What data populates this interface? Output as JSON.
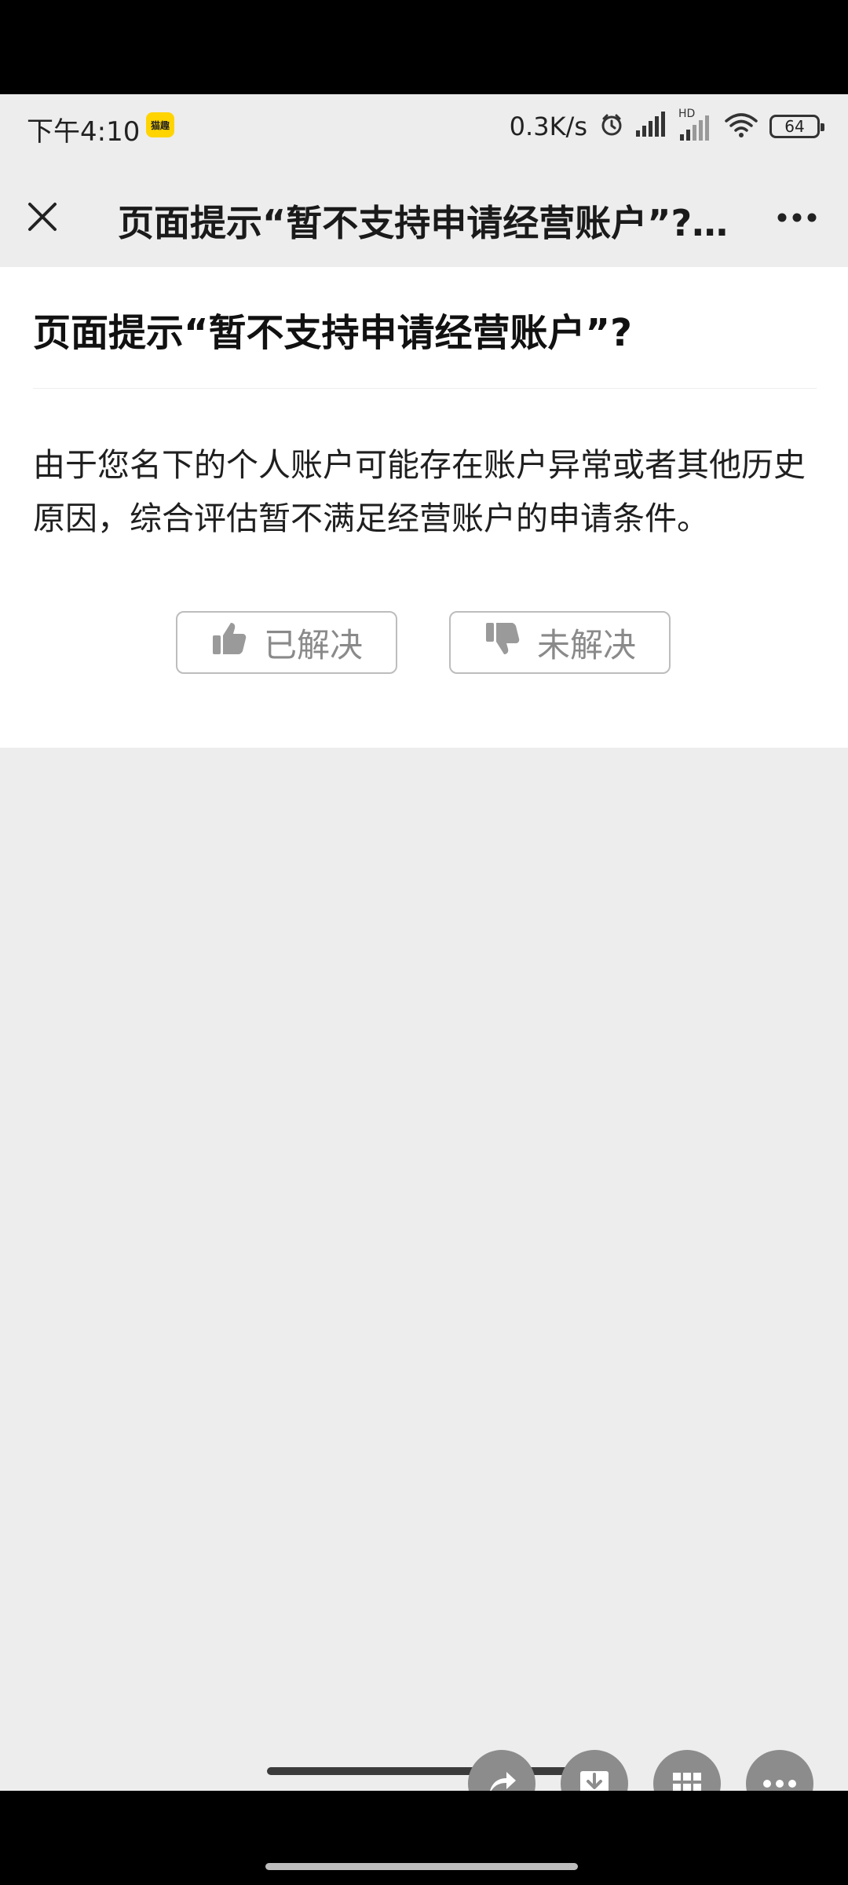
{
  "status": {
    "time": "下午4:10",
    "app_badge": "猫趣",
    "net_speed": "0.3K/s",
    "network": "HD",
    "battery": "64"
  },
  "navbar": {
    "title": "页面提示“暂不支持申请经营账户”? ..."
  },
  "article": {
    "title": "页面提示“暂不支持申请经营账户”?",
    "body": "由于您名下的个人账户可能存在账户异常或者其他历史原因，综合评估暂不满足经营账户的申请条件。"
  },
  "feedback": {
    "solved_label": "已解决",
    "unsolved_label": "未解决"
  },
  "icons": {
    "close": "close-icon",
    "more": "more-icon",
    "thumb_up": "thumbs-up-icon",
    "thumb_down": "thumbs-down-icon",
    "share": "share-icon",
    "download": "download-icon",
    "grid": "grid-icon",
    "more_floating": "more-horizontal-icon"
  },
  "colors": {
    "page_bg": "#ededed",
    "card_bg": "#ffffff",
    "button_border": "#bdbdbd",
    "button_text": "#8a8a8a",
    "floating_bg": "#8c8c8c"
  }
}
